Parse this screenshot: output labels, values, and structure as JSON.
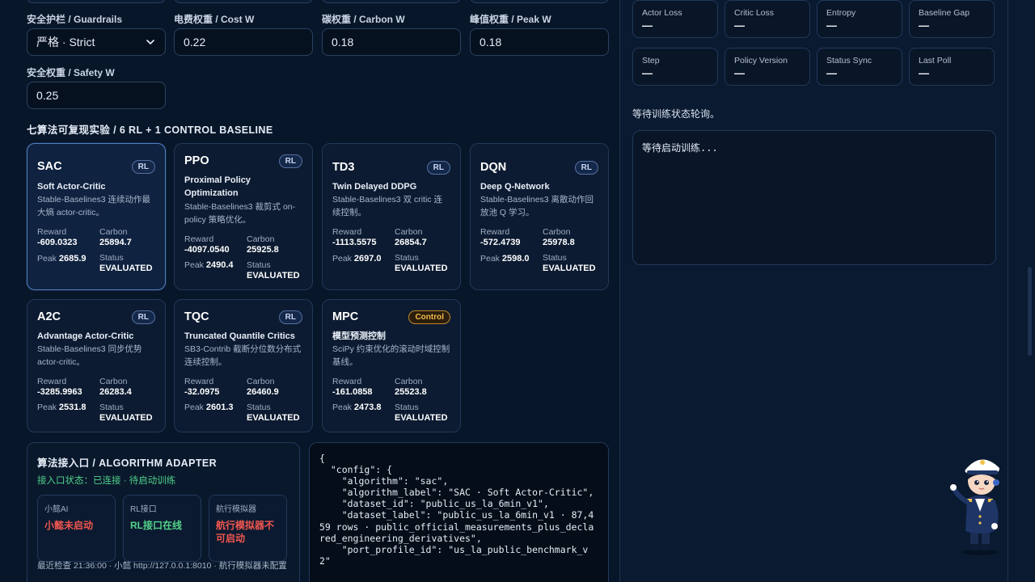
{
  "form": {
    "guardrails_label": "安全护栏 / Guardrails",
    "guardrails_value": "严格 · Strict",
    "cost_label": "电费权重 / Cost W",
    "cost_value": "0.22",
    "carbon_label": "碳权重 / Carbon W",
    "carbon_value": "0.18",
    "peak_label": "峰值权重 / Peak W",
    "peak_value": "0.18",
    "safety_label": "安全权重 / Safety W",
    "safety_value": "0.25"
  },
  "section_title": "七算法可复现实验 / 6 RL + 1 CONTROL BASELINE",
  "metric_labels": {
    "reward": "Reward",
    "carbon": "Carbon",
    "peak": "Peak",
    "status": "Status"
  },
  "algorithms": [
    {
      "name": "SAC",
      "badge": "RL",
      "subtitle": "Soft Actor-Critic",
      "desc": "Stable-Baselines3 连续动作最大熵 actor-critic。",
      "reward": "-609.0323",
      "carbon": "25894.7",
      "peak": "2685.9",
      "status": "EVALUATED"
    },
    {
      "name": "PPO",
      "badge": "RL",
      "subtitle": "Proximal Policy Optimization",
      "desc": "Stable-Baselines3 裁剪式 on-policy 策略优化。",
      "reward": "-4097.0540",
      "carbon": "25925.8",
      "peak": "2490.4",
      "status": "EVALUATED"
    },
    {
      "name": "TD3",
      "badge": "RL",
      "subtitle": "Twin Delayed DDPG",
      "desc": "Stable-Baselines3 双 critic 连续控制。",
      "reward": "-1113.5575",
      "carbon": "26854.7",
      "peak": "2697.0",
      "status": "EVALUATED"
    },
    {
      "name": "DQN",
      "badge": "RL",
      "subtitle": "Deep Q-Network",
      "desc": "Stable-Baselines3 离散动作回放池 Q 学习。",
      "reward": "-572.4739",
      "carbon": "25978.8",
      "peak": "2598.0",
      "status": "EVALUATED"
    },
    {
      "name": "A2C",
      "badge": "RL",
      "subtitle": "Advantage Actor-Critic",
      "desc": "Stable-Baselines3 同步优势 actor-critic。",
      "reward": "-3285.9963",
      "carbon": "26283.4",
      "peak": "2531.8",
      "status": "EVALUATED"
    },
    {
      "name": "TQC",
      "badge": "RL",
      "subtitle": "Truncated Quantile Critics",
      "desc": "SB3-Contrib 截断分位数分布式连续控制。",
      "reward": "-32.0975",
      "carbon": "26460.9",
      "peak": "2601.3",
      "status": "EVALUATED"
    },
    {
      "name": "MPC",
      "badge": "Control",
      "subtitle": "模型预测控制",
      "desc": "SciPy 约束优化的滚动时域控制基线。",
      "reward": "-161.0858",
      "carbon": "25523.8",
      "peak": "2473.8",
      "status": "EVALUATED"
    }
  ],
  "adapter": {
    "title": "算法接入口 / ALGORITHM ADAPTER",
    "status": "接入口状态：已连接 · 待启动训练",
    "cards": [
      {
        "label": "小懿AI",
        "value": "小懿未启动",
        "color": "#f0564f"
      },
      {
        "label": "RL接口",
        "value": "RL接口在线",
        "color": "#55d38a"
      },
      {
        "label": "航行模拟器",
        "value": "航行模拟器不可启动",
        "color": "#f0564f"
      }
    ],
    "footer": "最近检查 21:36:00 · 小懿 http://127.0.0.1:8010 · 航行模拟器未配置"
  },
  "config_json": "{\n  \"config\": {\n    \"algorithm\": \"sac\",\n    \"algorithm_label\": \"SAC · Soft Actor-Critic\",\n    \"dataset_id\": \"public_us_la_6min_v1\",\n    \"dataset_label\": \"public_us_la_6min_v1 · 87,459 rows · public_official_measurements_plus_declared_engineering_derivatives\",\n    \"port_profile_id\": \"us_la_public_benchmark_v2\"",
  "training_stats": [
    {
      "label": "Actor Loss",
      "value": "—"
    },
    {
      "label": "Critic Loss",
      "value": "—"
    },
    {
      "label": "Entropy",
      "value": "—"
    },
    {
      "label": "Baseline Gap",
      "value": "—"
    },
    {
      "label": "Step",
      "value": "—"
    },
    {
      "label": "Policy Version",
      "value": "—"
    },
    {
      "label": "Status Sync",
      "value": "—"
    },
    {
      "label": "Last Poll",
      "value": "—"
    }
  ],
  "poll_note": "等待训练状态轮询。",
  "log_text": "等待启动训练..."
}
